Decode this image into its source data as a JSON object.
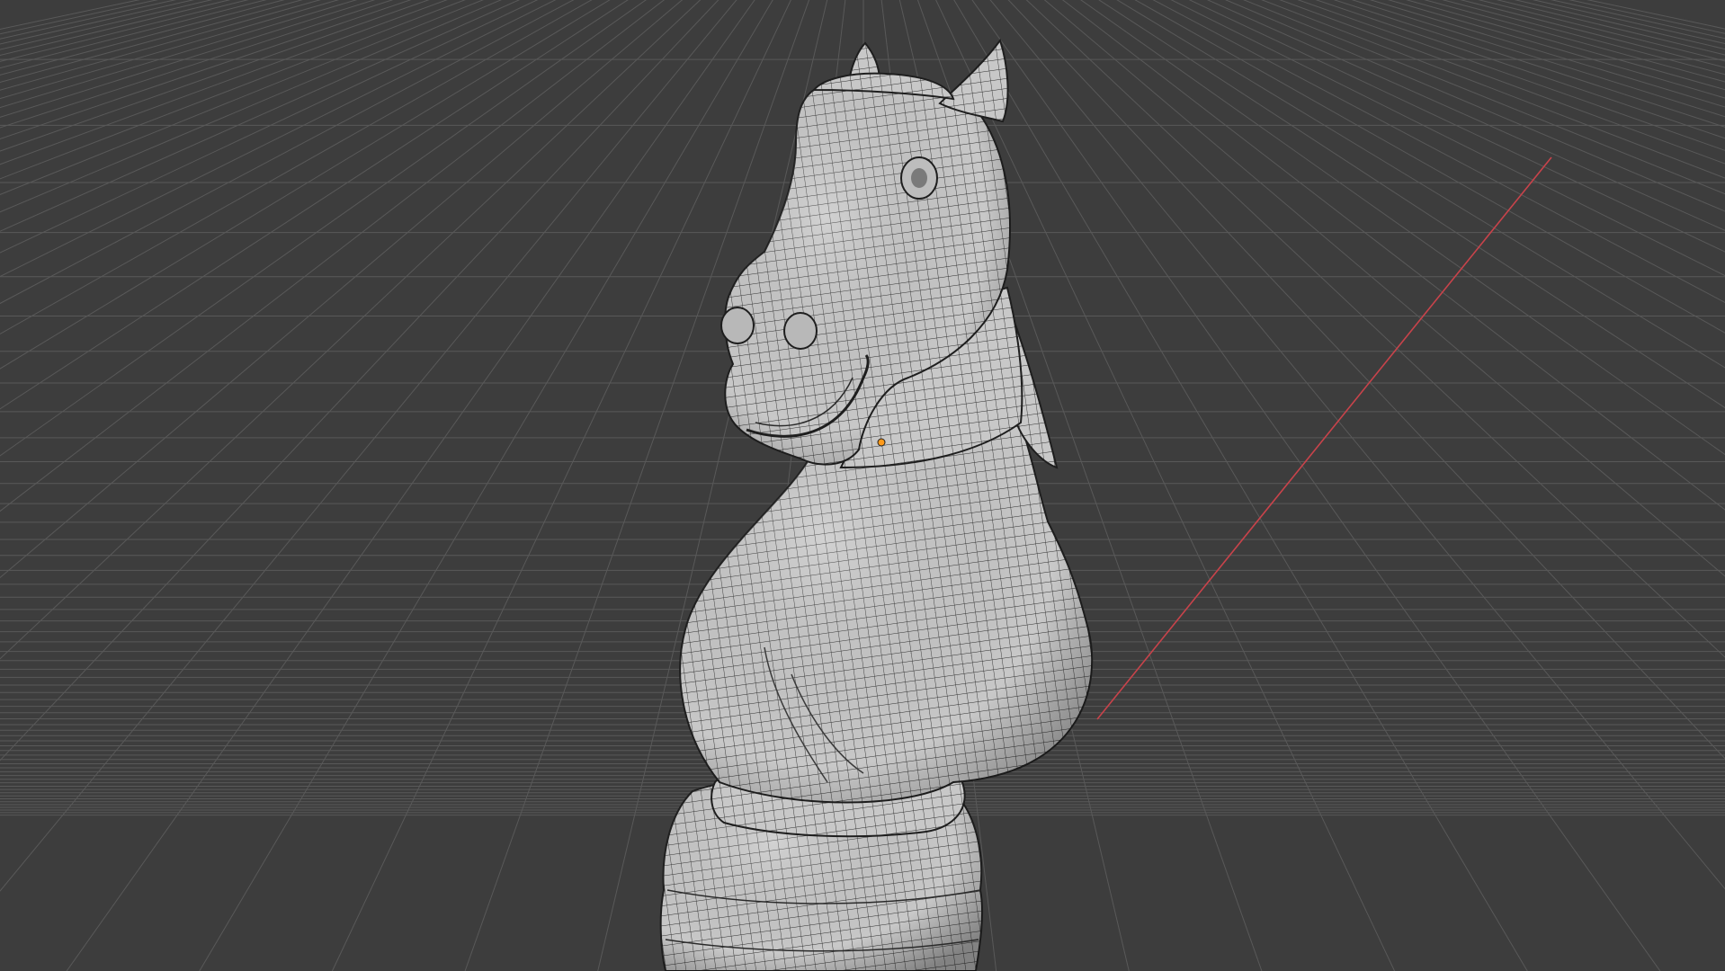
{
  "viewport": {
    "mode": "3D Viewport",
    "shading": "solid-wireframe",
    "colors": {
      "background": "#3d3d3d",
      "grid": "#5a5a5a",
      "x_axis": "#d0474f",
      "mesh_fill": "#c9c9c9",
      "mesh_wire": "#2b2b2b",
      "origin": "#ff9a1a"
    }
  },
  "object": {
    "name_icon": "knight-chess-piece-mesh",
    "origin_icon": "object-origin-dot"
  }
}
